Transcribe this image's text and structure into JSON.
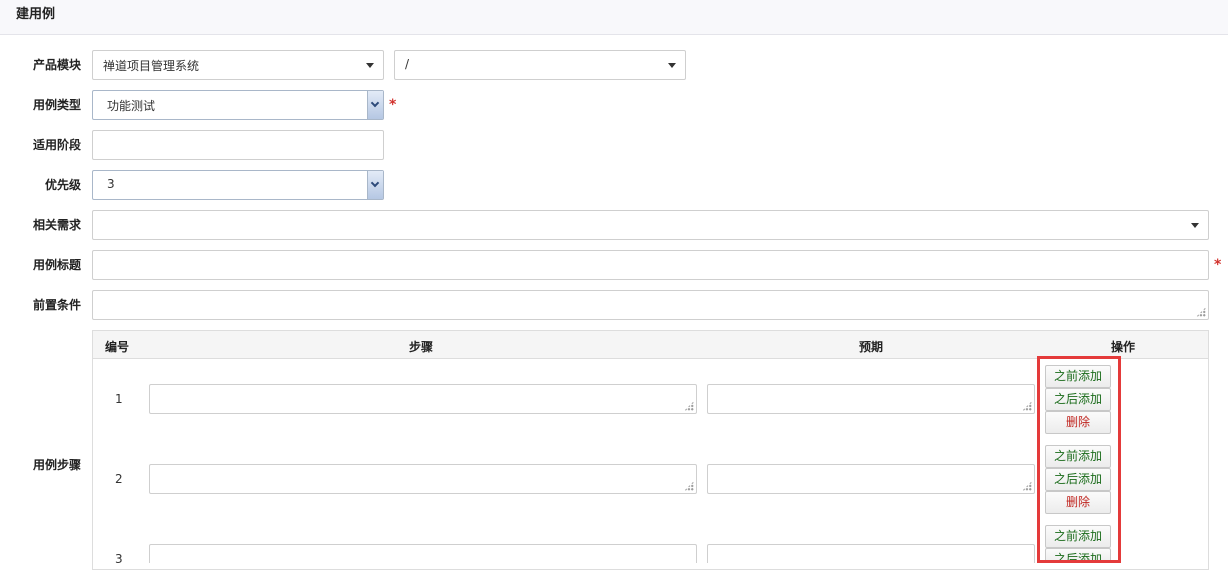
{
  "page": {
    "title": "建用例"
  },
  "form": {
    "product_module": {
      "label": "产品模块",
      "product_value": "禅道项目管理系统",
      "module_value": "/"
    },
    "case_type": {
      "label": "用例类型",
      "value": "功能测试",
      "required_mark": "*"
    },
    "stage": {
      "label": "适用阶段",
      "value": ""
    },
    "priority": {
      "label": "优先级",
      "value": "3"
    },
    "story": {
      "label": "相关需求",
      "value": ""
    },
    "title": {
      "label": "用例标题",
      "value": "",
      "required_mark": "*"
    },
    "precondition": {
      "label": "前置条件",
      "value": ""
    },
    "steps": {
      "label": "用例步骤",
      "headers": {
        "num": "编号",
        "step": "步骤",
        "expect": "预期",
        "action": "操作"
      },
      "rows": [
        {
          "num": "1",
          "step": "",
          "expect": ""
        },
        {
          "num": "2",
          "step": "",
          "expect": ""
        },
        {
          "num": "3",
          "step": "",
          "expect": ""
        }
      ],
      "actions": {
        "add_before": "之前添加",
        "add_after": "之后添加",
        "delete": "删除"
      }
    }
  },
  "colors": {
    "required": "#d2322d",
    "add_text": "#1a6b1a",
    "delete_text": "#c0251f",
    "highlight_border": "#e43a3a"
  }
}
